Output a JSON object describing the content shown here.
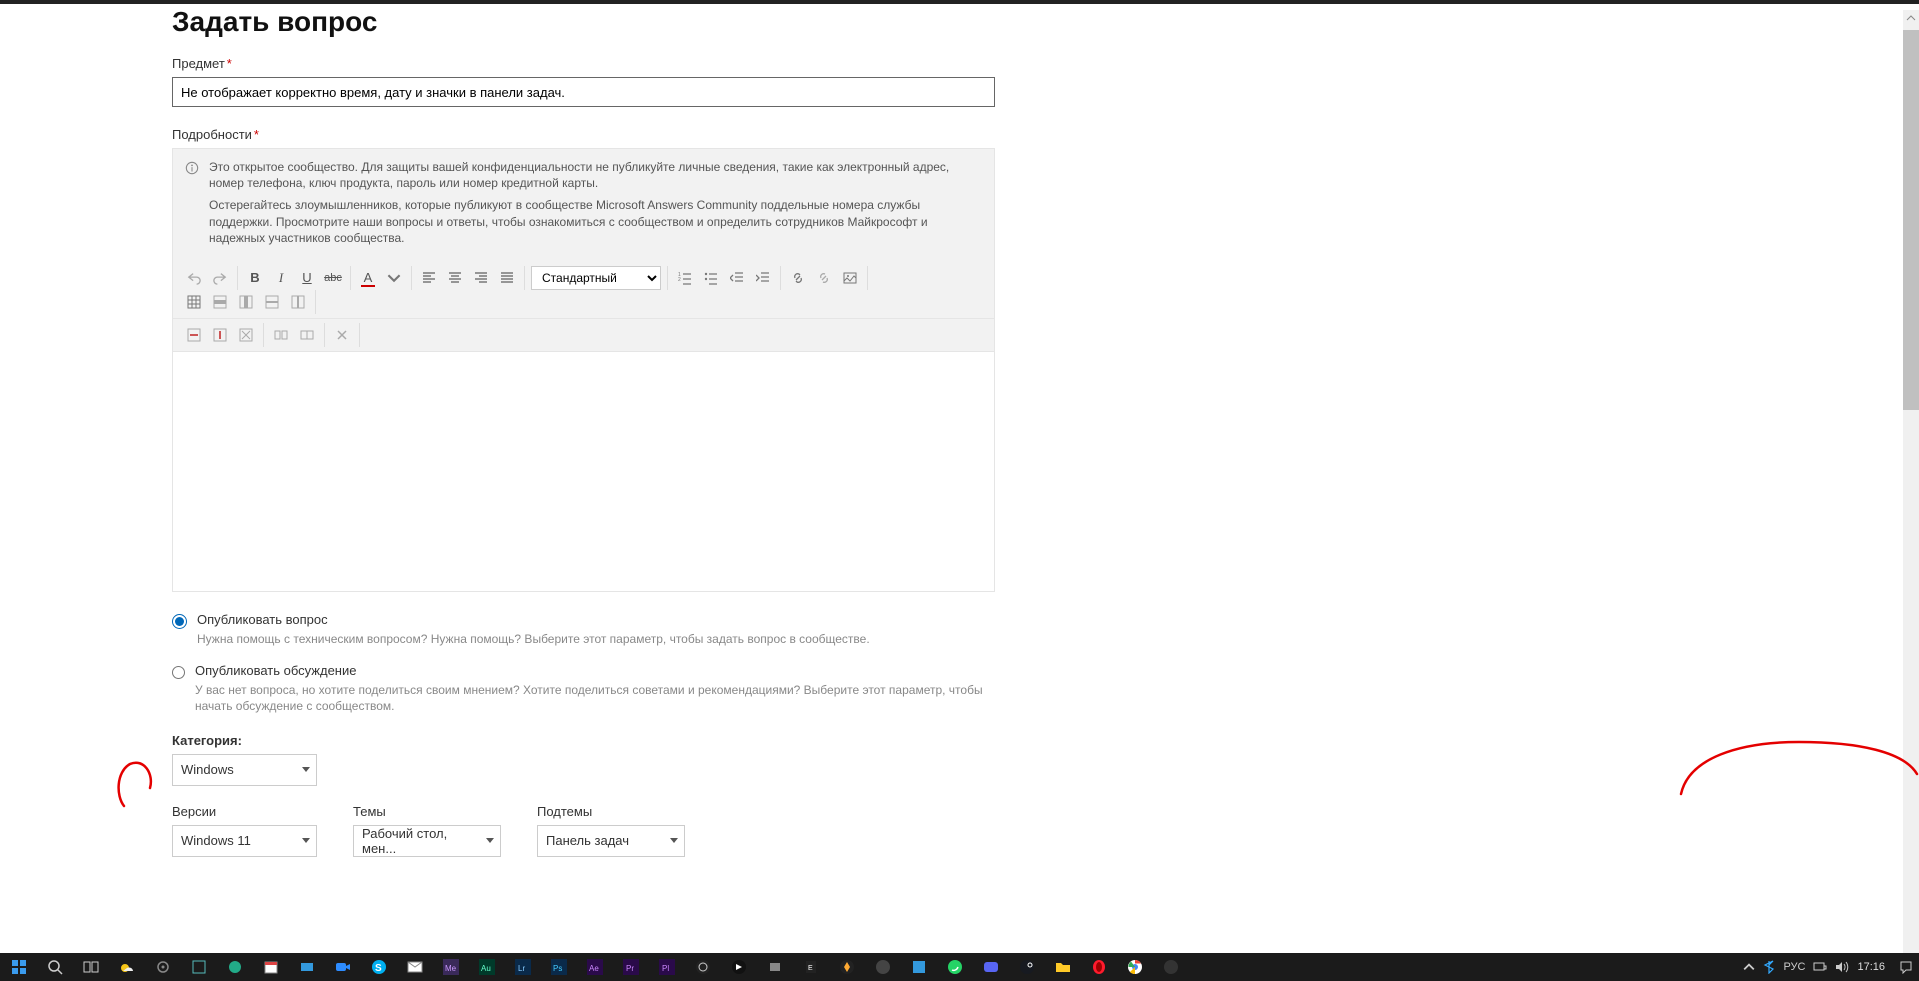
{
  "page": {
    "title": "Задать вопрос"
  },
  "subject": {
    "label": "Предмет",
    "value": "Не отображает корректно время, дату и значки в панели задач."
  },
  "details": {
    "label": "Подробности",
    "notice_p1": "Это открытое сообщество. Для защиты вашей конфиденциальности не публикуйте личные сведения, такие как электронный адрес, номер телефона, ключ продукта, пароль или номер кредитной карты.",
    "notice_p2": "Остерегайтесь злоумышленников, которые публикуют в сообществе Microsoft Answers Community поддельные номера службы поддержки.  Просмотрите наши вопросы и ответы, чтобы ознакомиться с сообществом и определить сотрудников Майкрософт и надежных участников сообщества."
  },
  "toolbar": {
    "font_select": "Стандартный"
  },
  "post_type": {
    "option1": {
      "label": "Опубликовать вопрос",
      "desc": "Нужна помощь с техническим вопросом? Нужна помощь? Выберите этот параметр, чтобы задать вопрос в сообществе."
    },
    "option2": {
      "label": "Опубликовать обсуждение",
      "desc": "У вас нет вопроса, но хотите поделиться своим мнением? Хотите поделиться советами и рекомендациями? Выберите этот параметр, чтобы начать обсуждение с сообществом."
    }
  },
  "category": {
    "label": "Категория:",
    "value": "Windows"
  },
  "versions": {
    "label": "Версии",
    "value": "Windows 11"
  },
  "topics": {
    "label": "Темы",
    "value": "Рабочий стол, мен..."
  },
  "subtopics": {
    "label": "Подтемы",
    "value": "Панель задач"
  },
  "tray": {
    "lang": "РУС",
    "time": "17:16"
  }
}
